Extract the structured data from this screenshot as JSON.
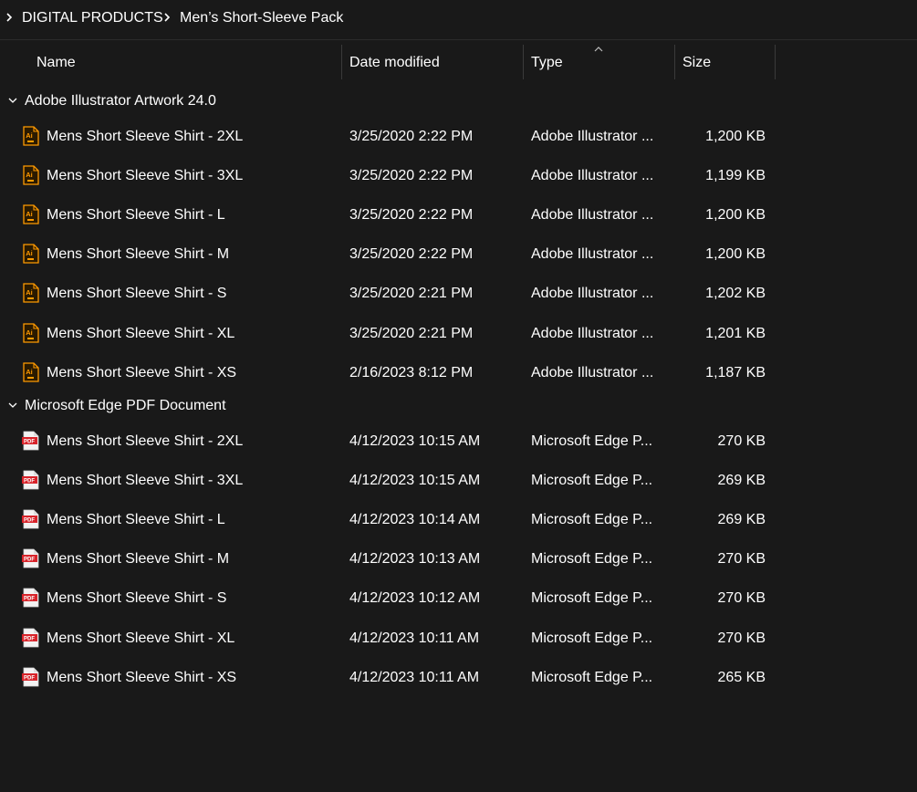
{
  "breadcrumb": {
    "items": [
      "DIGITAL PRODUCTS",
      "Men’s Short-Sleeve Pack"
    ]
  },
  "columns": {
    "name": "Name",
    "date": "Date modified",
    "type": "Type",
    "size": "Size"
  },
  "groups": [
    {
      "title": "Adobe Illustrator Artwork 24.0",
      "icon": "illustrator-file-icon",
      "rows": [
        {
          "name": "Mens Short Sleeve Shirt - 2XL",
          "date": "3/25/2020 2:22 PM",
          "type": "Adobe Illustrator ...",
          "size": "1,200 KB"
        },
        {
          "name": "Mens Short Sleeve Shirt - 3XL",
          "date": "3/25/2020 2:22 PM",
          "type": "Adobe Illustrator ...",
          "size": "1,199 KB"
        },
        {
          "name": "Mens Short Sleeve Shirt - L",
          "date": "3/25/2020 2:22 PM",
          "type": "Adobe Illustrator ...",
          "size": "1,200 KB"
        },
        {
          "name": "Mens Short Sleeve Shirt - M",
          "date": "3/25/2020 2:22 PM",
          "type": "Adobe Illustrator ...",
          "size": "1,200 KB"
        },
        {
          "name": "Mens Short Sleeve Shirt - S",
          "date": "3/25/2020 2:21 PM",
          "type": "Adobe Illustrator ...",
          "size": "1,202 KB"
        },
        {
          "name": "Mens Short Sleeve Shirt - XL",
          "date": "3/25/2020 2:21 PM",
          "type": "Adobe Illustrator ...",
          "size": "1,201 KB"
        },
        {
          "name": "Mens Short Sleeve Shirt - XS",
          "date": "2/16/2023 8:12 PM",
          "type": "Adobe Illustrator ...",
          "size": "1,187 KB"
        }
      ]
    },
    {
      "title": "Microsoft Edge PDF Document",
      "icon": "pdf-file-icon",
      "rows": [
        {
          "name": "Mens Short Sleeve Shirt - 2XL",
          "date": "4/12/2023 10:15 AM",
          "type": "Microsoft Edge P...",
          "size": "270 KB"
        },
        {
          "name": "Mens Short Sleeve Shirt - 3XL",
          "date": "4/12/2023 10:15 AM",
          "type": "Microsoft Edge P...",
          "size": "269 KB"
        },
        {
          "name": "Mens Short Sleeve Shirt - L",
          "date": "4/12/2023 10:14 AM",
          "type": "Microsoft Edge P...",
          "size": "269 KB"
        },
        {
          "name": "Mens Short Sleeve Shirt - M",
          "date": "4/12/2023 10:13 AM",
          "type": "Microsoft Edge P...",
          "size": "270 KB"
        },
        {
          "name": "Mens Short Sleeve Shirt - S",
          "date": "4/12/2023 10:12 AM",
          "type": "Microsoft Edge P...",
          "size": "270 KB"
        },
        {
          "name": "Mens Short Sleeve Shirt - XL",
          "date": "4/12/2023 10:11 AM",
          "type": "Microsoft Edge P...",
          "size": "270 KB"
        },
        {
          "name": "Mens Short Sleeve Shirt - XS",
          "date": "4/12/2023 10:11 AM",
          "type": "Microsoft Edge P...",
          "size": "265 KB"
        }
      ]
    }
  ],
  "colors": {
    "background": "#191919",
    "text": "#ffffff",
    "illustrator_accent": "#ff9a00",
    "pdf_accent": "#d8232a"
  }
}
